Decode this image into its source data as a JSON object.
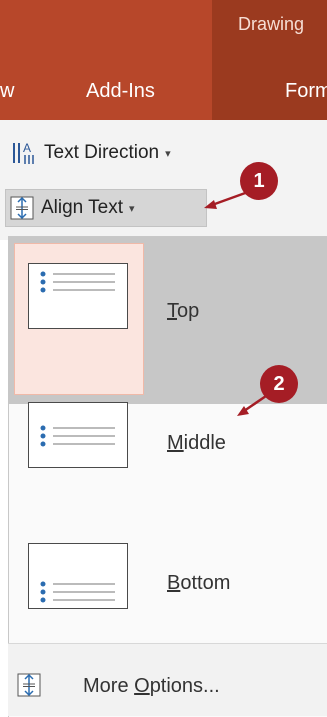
{
  "ribbon": {
    "context_label": "Drawing",
    "tabs": [
      {
        "label": "w"
      },
      {
        "label": "Add-Ins"
      },
      {
        "label": "Form"
      }
    ],
    "colors": {
      "ribbon": "#b7472a",
      "context": "#9b3a1f"
    }
  },
  "commands": {
    "text_direction": {
      "label": "Text Direction",
      "icon": "text-direction-icon",
      "caret": "▾"
    },
    "align_text": {
      "label": "Align Text",
      "icon": "align-text-icon",
      "caret": "▾"
    }
  },
  "dropdown": {
    "options": [
      {
        "label": "Top",
        "mnemonic": "T",
        "rest": "op",
        "icon": "align-top-icon",
        "selected": true
      },
      {
        "label": "Middle",
        "mnemonic": "M",
        "rest": "iddle",
        "icon": "align-middle-icon",
        "selected": false
      },
      {
        "label": "Bottom",
        "mnemonic": "B",
        "rest": "ottom",
        "icon": "align-bottom-icon",
        "selected": false
      }
    ],
    "more_options": {
      "prefix": "More ",
      "mnemonic": "O",
      "rest": "ptions...",
      "icon": "more-options-icon"
    }
  },
  "callouts": [
    {
      "number": "1",
      "color": "#a51d25"
    },
    {
      "number": "2",
      "color": "#a51d25"
    }
  ]
}
